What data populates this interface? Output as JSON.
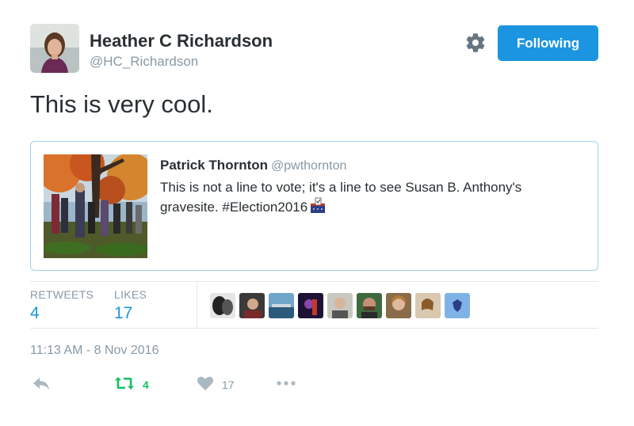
{
  "author": {
    "name": "Heather C Richardson",
    "handle": "@HC_Richardson"
  },
  "header": {
    "follow_label": "Following"
  },
  "tweet": {
    "text": "This is very cool."
  },
  "quoted": {
    "name": "Patrick Thornton",
    "handle": "@pwthornton",
    "text": "This is not a line to vote; it's a line to see Susan B. Anthony's gravesite. #Election2016"
  },
  "stats": {
    "retweets_label": "RETWEETS",
    "retweets_value": "4",
    "likes_label": "LIKES",
    "likes_value": "17"
  },
  "timestamp": "11:13 AM - 8 Nov 2016",
  "actions": {
    "retweet_count": "4",
    "like_count": "17"
  },
  "colors": {
    "accent": "#1b95e0",
    "retweet_green": "#17bf63",
    "muted": "#8899a6"
  },
  "icons": [
    "gear-icon",
    "reply-icon",
    "retweet-icon",
    "heart-icon",
    "more-icon",
    "ballot-box-icon"
  ]
}
